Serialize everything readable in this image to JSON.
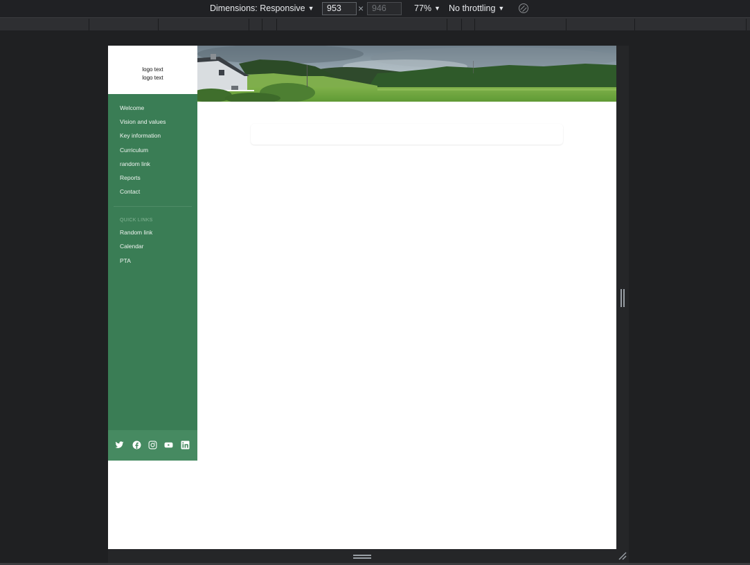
{
  "devtools": {
    "dimensions_label": "Dimensions: Responsive",
    "width_value": "953",
    "height_placeholder": "946",
    "times_symbol": "×",
    "zoom_label": "77%",
    "throttling_label": "No throttling",
    "rotate_icon": "rotate-icon"
  },
  "page": {
    "logo": {
      "line1": "logo text",
      "line2": "logo text"
    },
    "nav": [
      {
        "label": "Welcome"
      },
      {
        "label": "Vision and values"
      },
      {
        "label": "Key information"
      },
      {
        "label": "Curriculum"
      },
      {
        "label": "random link"
      },
      {
        "label": "Reports"
      },
      {
        "label": "Contact"
      }
    ],
    "quick_links": {
      "heading": "QUICK LINKS",
      "items": [
        {
          "label": "Random link"
        },
        {
          "label": "Calendar"
        },
        {
          "label": "PTA"
        }
      ]
    },
    "social": [
      {
        "icon": "twitter-icon"
      },
      {
        "icon": "facebook-icon"
      },
      {
        "icon": "instagram-icon"
      },
      {
        "icon": "youtube-icon"
      },
      {
        "icon": "linkedin-icon"
      }
    ],
    "hero_image": "landscape photo with white farmhouse, green hills and forest under cloudy sky",
    "colors": {
      "sidebar": "#3a7d55",
      "social_bar": "#468a61",
      "nav_text": "#f0f5f1",
      "quick_links_heading": "#86b697"
    }
  }
}
